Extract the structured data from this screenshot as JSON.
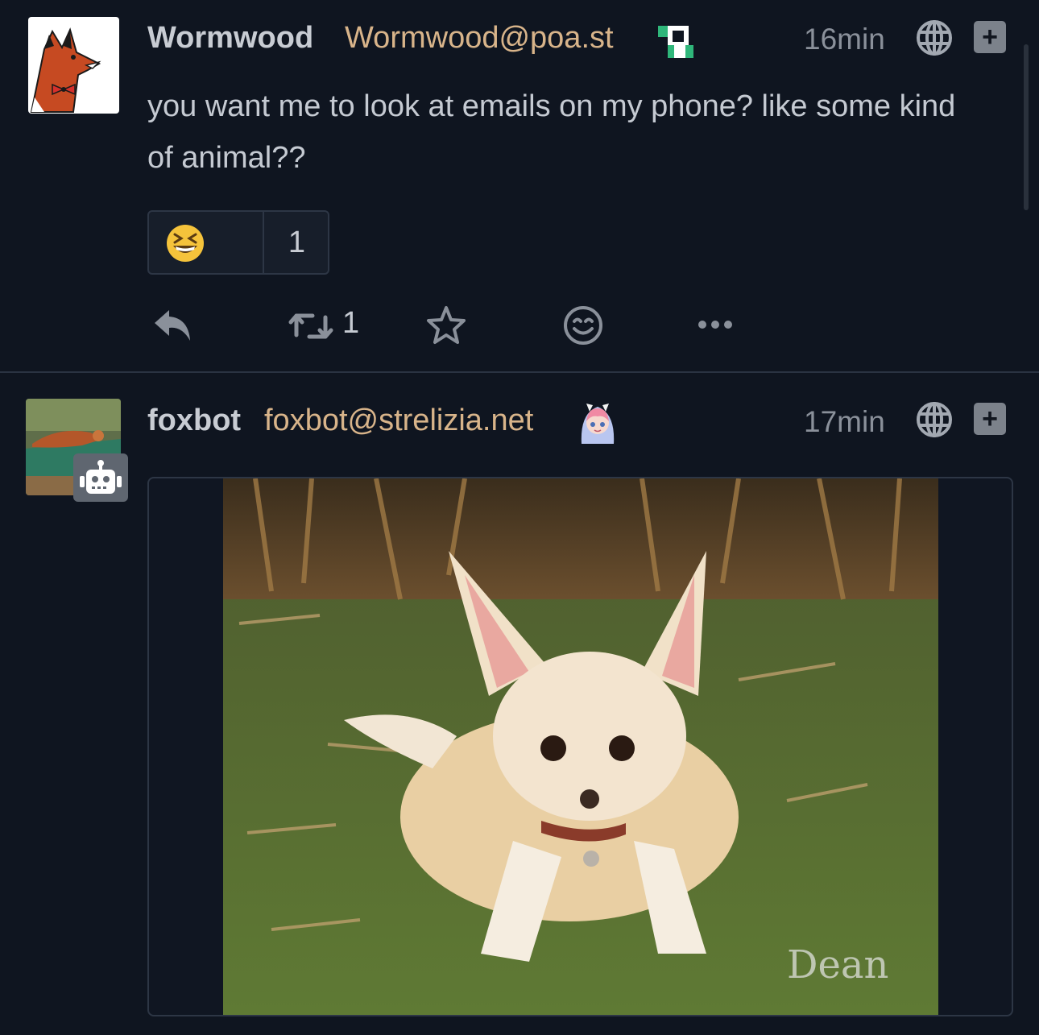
{
  "posts": [
    {
      "author": {
        "display_name": "Wormwood",
        "handle": "Wormwood@poa.st",
        "avatar": "red-fox-cartoon-avatar",
        "instance_badge": "pleroma-logo-icon"
      },
      "time": "16min",
      "visibility_icon": "globe-icon",
      "content": "you want me to look at emails on my phone? like some kind of animal??",
      "reactions": [
        {
          "emoji": "grinning-squinting-face",
          "count": "1"
        }
      ],
      "actions": {
        "reply_icon": "reply-icon",
        "boost_icon": "boost-icon",
        "boost_count": "1",
        "favorite_icon": "star-icon",
        "react_icon": "smile-icon",
        "more_icon": "ellipsis-icon"
      }
    },
    {
      "author": {
        "display_name": "foxbot",
        "handle": "foxbot@strelizia.net",
        "avatar": "fox-photo-avatar",
        "bot_badge": "robot-icon",
        "instance_badge": "anime-girl-icon"
      },
      "time": "17min",
      "visibility_icon": "globe-icon",
      "media": {
        "description": "fennec-fox-photo"
      }
    }
  ],
  "colors": {
    "background": "#0f1520",
    "name": "#c8ccd3",
    "handle": "#d8b48a",
    "muted": "#8a909a",
    "border": "#2d3645"
  }
}
